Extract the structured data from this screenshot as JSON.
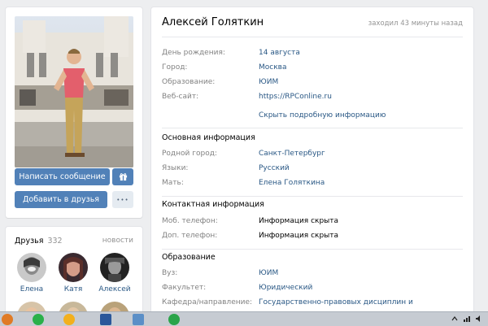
{
  "profile": {
    "name": "Алексей Голяткин",
    "last_seen": "заходил 43 минуты назад"
  },
  "actions": {
    "message_label": "Написать сообщение",
    "gift_icon": "gift-icon",
    "add_friend_label": "Добавить в друзья",
    "more_label": "•••"
  },
  "info": [
    {
      "label": "День рождения:",
      "value": "14 августа",
      "link": true
    },
    {
      "label": "Город:",
      "value": "Москва",
      "link": true
    },
    {
      "label": "Образование:",
      "value": "ЮИМ",
      "link": true
    },
    {
      "label": "Веб-сайт:",
      "value": "https://RPConline.ru",
      "link": true
    }
  ],
  "toggle_label": "Скрыть подробную информацию",
  "sections": {
    "basic": {
      "title": "Основная информация",
      "rows": [
        {
          "label": "Родной город:",
          "value": "Санкт-Петербург"
        },
        {
          "label": "Языки:",
          "value": "Русский"
        },
        {
          "label": "Мать:",
          "value": "Елена Голяткина"
        }
      ]
    },
    "contacts": {
      "title": "Контактная информация",
      "rows": [
        {
          "label": "Моб. телефон:",
          "value": "Информация скрыта"
        },
        {
          "label": "Доп. телефон:",
          "value": "Информация скрыта"
        }
      ]
    },
    "education": {
      "title": "Образование",
      "rows": [
        {
          "label": "Вуз:",
          "value": "ЮИМ"
        },
        {
          "label": "Факультет:",
          "value": "Юридический"
        },
        {
          "label": "Кафедра/направление:",
          "value": "Государственно-правовых дисциплин и"
        }
      ]
    }
  },
  "friends": {
    "title": "Друзья",
    "count": "332",
    "link": "новости",
    "items": [
      {
        "name": "Елена"
      },
      {
        "name": "Катя"
      },
      {
        "name": "Алексей"
      }
    ]
  },
  "colors": {
    "accent": "#5181b8",
    "link": "#2a5885",
    "label": "#828282"
  }
}
